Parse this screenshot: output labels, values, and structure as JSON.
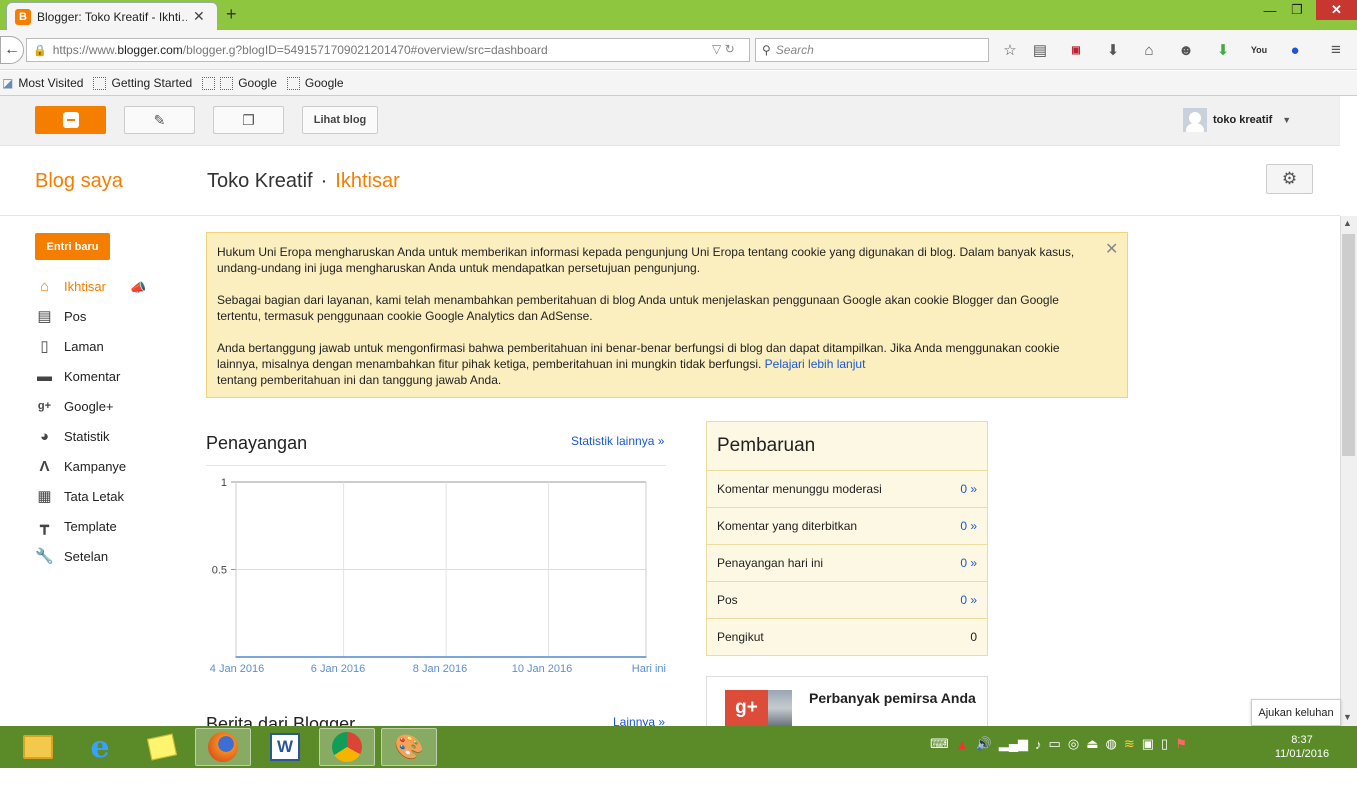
{
  "browser": {
    "tab_title": "Blogger: Toko Kreatif - Ikhti…",
    "url_prefix": "https://www.",
    "url_domain": "blogger.com",
    "url_rest": "/blogger.g?blogID=5491571709021201470#overview/src=dashboard",
    "search_placeholder": "Search",
    "bookmarks": [
      "Most Visited",
      "Getting Started",
      "Google",
      "Google"
    ]
  },
  "header": {
    "view_blog": "Lihat blog",
    "user_name": "toko kreatif"
  },
  "subheader": {
    "my_blogs": "Blog saya",
    "blog_name": "Toko Kreatif",
    "separator": "·",
    "current_page": "Ikhtisar"
  },
  "sidebar": {
    "new_post": "Entri baru",
    "items": [
      {
        "label": "Ikhtisar",
        "icon": "home-icon"
      },
      {
        "label": "Pos",
        "icon": "posts-icon"
      },
      {
        "label": "Laman",
        "icon": "pages-icon"
      },
      {
        "label": "Komentar",
        "icon": "comment-icon"
      },
      {
        "label": "Google+",
        "icon": "google-plus-icon"
      },
      {
        "label": "Statistik",
        "icon": "pie-chart-icon"
      },
      {
        "label": "Kampanye",
        "icon": "campaign-icon"
      },
      {
        "label": "Tata Letak",
        "icon": "layout-icon"
      },
      {
        "label": "Template",
        "icon": "template-icon"
      },
      {
        "label": "Setelan",
        "icon": "wrench-icon"
      }
    ]
  },
  "notice": {
    "p1": "Hukum Uni Eropa mengharuskan Anda untuk memberikan informasi kepada pengunjung Uni Eropa tentang cookie yang digunakan di blog. Dalam banyak kasus, undang-undang ini juga mengharuskan Anda untuk mendapatkan persetujuan pengunjung.",
    "p2": "Sebagai bagian dari layanan, kami telah menambahkan pemberitahuan di blog Anda untuk menjelaskan penggunaan Google akan cookie Blogger dan Google tertentu, termasuk penggunaan cookie Google Analytics dan AdSense.",
    "p3_a": "Anda bertanggung jawab untuk mengonfirmasi bahwa pemberitahuan ini benar-benar berfungsi di blog dan dapat ditampilkan. Jika Anda menggunakan cookie lainnya, misalnya dengan menambahkan fitur pihak ketiga, pemberitahuan ini mungkin tidak berfungsi.",
    "p3_link": "Pelajari lebih lanjut",
    "p3_b": "tentang pemberitahuan ini dan tanggung jawab Anda."
  },
  "views": {
    "title": "Penayangan",
    "more_link": "Statistik lainnya »"
  },
  "chart_data": {
    "type": "line",
    "title": "",
    "xlabel": "",
    "ylabel": "",
    "categories": [
      "4 Jan 2016",
      "6 Jan 2016",
      "8 Jan 2016",
      "10 Jan 2016",
      "Hari ini"
    ],
    "series": [
      {
        "values": [
          0,
          0,
          0,
          0,
          0
        ]
      }
    ],
    "yticks": [
      "1",
      "0.5"
    ],
    "ylim": [
      0,
      1
    ],
    "grid": true,
    "line_color": "#7aa6d8"
  },
  "updates": {
    "title": "Pembaruan",
    "rows": [
      {
        "label": "Komentar menunggu moderasi",
        "value": "0 »"
      },
      {
        "label": "Komentar yang diterbitkan",
        "value": "0 »"
      },
      {
        "label": "Penayangan hari ini",
        "value": "0 »"
      },
      {
        "label": "Pos",
        "value": "0 »"
      },
      {
        "label": "Pengikut",
        "value": "0"
      }
    ]
  },
  "promo": {
    "title": "Perbanyak pemirsa Anda",
    "badge": "g+"
  },
  "news": {
    "title": "Berita dari Blogger",
    "more_link": "Lainnya »"
  },
  "feedback": "Ajukan keluhan",
  "taskbar": {
    "time": "8:37",
    "date": "11/01/2016"
  },
  "colors": {
    "accent": "#f57d00",
    "link": "#1a57d6",
    "notice_bg": "#fcefbf",
    "taskbar": "#5b8b29"
  }
}
